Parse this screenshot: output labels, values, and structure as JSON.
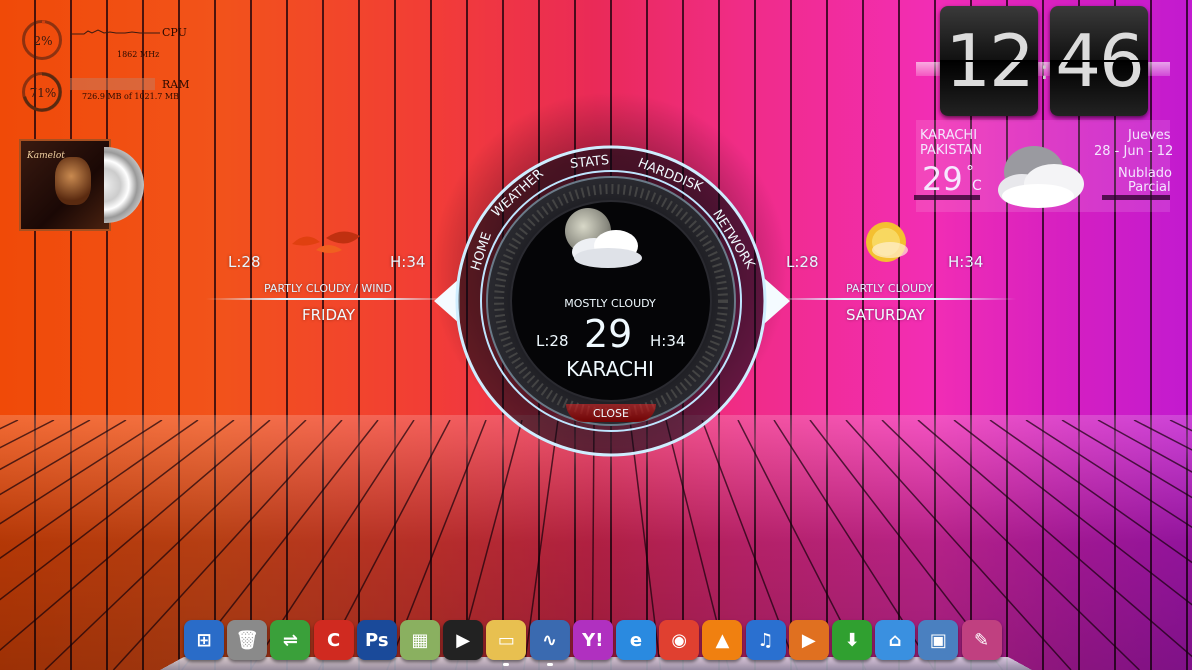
{
  "system": {
    "cpu": {
      "percent": "2%",
      "label": "CPU",
      "speed": "1862 MHz"
    },
    "ram": {
      "percent": "71%",
      "label": "RAM",
      "usage": "726.9 MB of 1021.7 MB"
    }
  },
  "clock": {
    "hour": "12",
    "minute": "46"
  },
  "weather_widget": {
    "city": "KARACHI",
    "country": "PAKISTAN",
    "temperature": "29",
    "degree": "°",
    "unit": "C",
    "day": "Jueves",
    "date": "28 - Jun - 12",
    "condition_line1": "Nublado",
    "condition_line2": "Parcial"
  },
  "forecast_left": {
    "low": "L:28",
    "high": "H:34",
    "condition": "PARTLY CLOUDY / WIND",
    "day": "FRIDAY"
  },
  "forecast_right": {
    "low": "L:28",
    "high": "H:34",
    "condition": "PARTLY CLOUDY",
    "day": "SATURDAY"
  },
  "hud": {
    "menu": [
      "HOME",
      "WEATHER",
      "STATS",
      "HARDDISK",
      "NETWORK"
    ],
    "condition": "MOSTLY CLOUDY",
    "low": "L:28",
    "temperature": "29",
    "high": "H:34",
    "city": "KARACHI",
    "close_label": "CLOSE"
  },
  "album": {
    "band": "Kamelot"
  },
  "dock": {
    "icons": [
      {
        "name": "windows-start-icon",
        "glyph": "⊞",
        "color": "#2a6cc8"
      },
      {
        "name": "recycle-bin-icon",
        "glyph": "🗑",
        "color": "#8a8a8a"
      },
      {
        "name": "usb-drive-icon",
        "glyph": "⇌",
        "color": "#3aa03a"
      },
      {
        "name": "ccleaner-icon",
        "glyph": "C",
        "color": "#d02a20"
      },
      {
        "name": "photoshop-icon",
        "glyph": "Ps",
        "color": "#1a4a9a"
      },
      {
        "name": "image-viewer-icon",
        "glyph": "▦",
        "color": "#8ab060"
      },
      {
        "name": "video-camera-icon",
        "glyph": "▶",
        "color": "#222222"
      },
      {
        "name": "folder-icon",
        "glyph": "▭",
        "color": "#e8c050"
      },
      {
        "name": "task-manager-icon",
        "glyph": "∿",
        "color": "#3a6ab0"
      },
      {
        "name": "yahoo-messenger-icon",
        "glyph": "Y!",
        "color": "#b030c0"
      },
      {
        "name": "internet-explorer-icon",
        "glyph": "e",
        "color": "#2a8ae0"
      },
      {
        "name": "chrome-icon",
        "glyph": "◉",
        "color": "#e04030"
      },
      {
        "name": "vlc-icon",
        "glyph": "▲",
        "color": "#f08010"
      },
      {
        "name": "itunes-icon",
        "glyph": "♫",
        "color": "#2a70d0"
      },
      {
        "name": "media-player-icon",
        "glyph": "▶",
        "color": "#e07020"
      },
      {
        "name": "download-icon",
        "glyph": "⬇",
        "color": "#30a030"
      },
      {
        "name": "home-folder-icon",
        "glyph": "⌂",
        "color": "#3a90e0"
      },
      {
        "name": "computer-icon",
        "glyph": "▣",
        "color": "#4a80c0"
      },
      {
        "name": "paint-icon",
        "glyph": "✎",
        "color": "#c04080"
      }
    ]
  }
}
